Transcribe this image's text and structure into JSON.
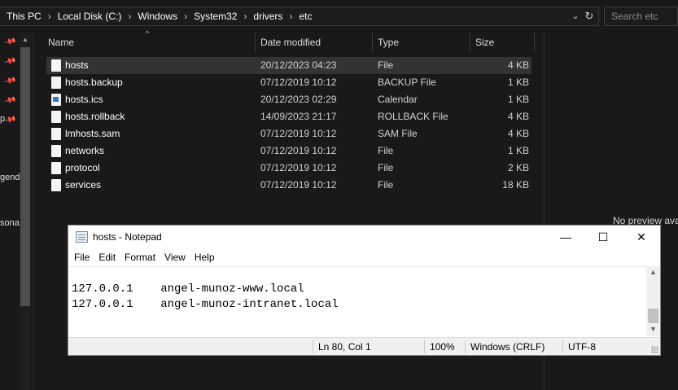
{
  "explorer": {
    "breadcrumb": [
      "This PC",
      "Local Disk (C:)",
      "Windows",
      "System32",
      "drivers",
      "etc"
    ],
    "search_placeholder": "Search etc",
    "nav_fragments": [
      "p",
      "gend",
      "sona"
    ],
    "columns": {
      "name": "Name",
      "date": "Date modified",
      "type": "Type",
      "size": "Size"
    },
    "files": [
      {
        "name": "hosts",
        "date": "20/12/2023 04:23",
        "type": "File",
        "size": "4 KB",
        "icon": "file-icon",
        "selected": true
      },
      {
        "name": "hosts.backup",
        "date": "07/12/2019 10:12",
        "type": "BACKUP File",
        "size": "1 KB",
        "icon": "file-icon"
      },
      {
        "name": "hosts.ics",
        "date": "20/12/2023 02:29",
        "type": "Calendar",
        "size": "1 KB",
        "icon": "calendar-file-icon"
      },
      {
        "name": "hosts.rollback",
        "date": "14/09/2023 21:17",
        "type": "ROLLBACK File",
        "size": "4 KB",
        "icon": "file-icon"
      },
      {
        "name": "lmhosts.sam",
        "date": "07/12/2019 10:12",
        "type": "SAM File",
        "size": "4 KB",
        "icon": "file-icon"
      },
      {
        "name": "networks",
        "date": "07/12/2019 10:12",
        "type": "File",
        "size": "1 KB",
        "icon": "file-icon"
      },
      {
        "name": "protocol",
        "date": "07/12/2019 10:12",
        "type": "File",
        "size": "2 KB",
        "icon": "file-icon"
      },
      {
        "name": "services",
        "date": "07/12/2019 10:12",
        "type": "File",
        "size": "18 KB",
        "icon": "file-icon"
      }
    ],
    "preview_text": "No preview ava"
  },
  "notepad": {
    "title": "hosts - Notepad",
    "menu": [
      "File",
      "Edit",
      "Format",
      "View",
      "Help"
    ],
    "lines": [
      "127.0.0.1    angel-munoz-www.local",
      "127.0.0.1    angel-munoz-intranet.local"
    ],
    "status": {
      "position": "Ln 80, Col 1",
      "zoom": "100%",
      "line_ending": "Windows (CRLF)",
      "encoding": "UTF-8"
    },
    "buttons": {
      "minimize": "—",
      "maximize": "☐",
      "close": "✕"
    }
  },
  "colors": {
    "explorer_bg": "#191919",
    "selected_row": "#333333",
    "notepad_bg": "#ffffff",
    "statusbar_bg": "#f0f0f0"
  }
}
